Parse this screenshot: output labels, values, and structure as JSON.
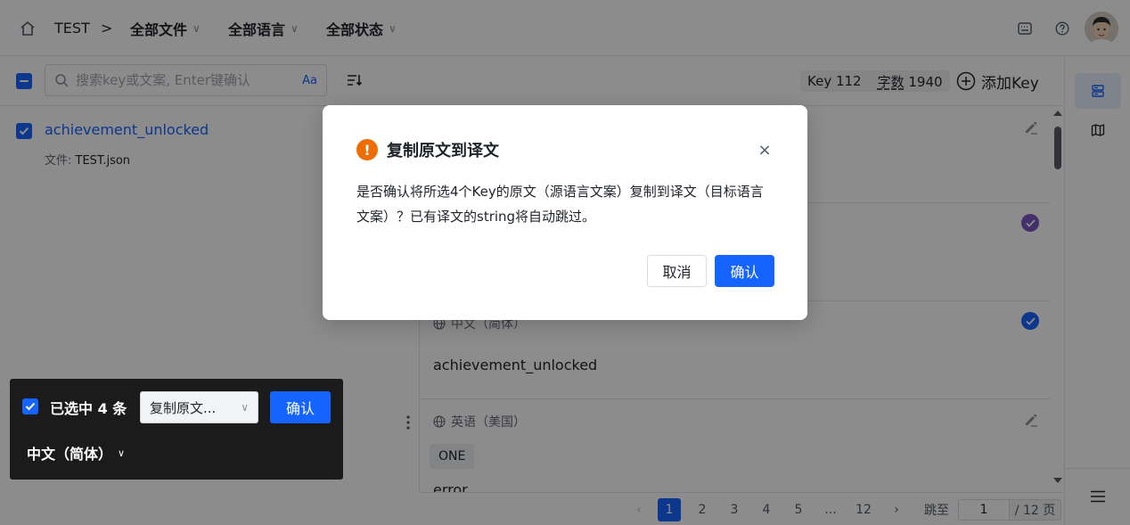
{
  "header": {
    "project": "TEST",
    "breadcrumb_sep": ">",
    "filters": [
      {
        "label": "全部文件"
      },
      {
        "label": "全部语言"
      },
      {
        "label": "全部状态"
      }
    ]
  },
  "toolbar": {
    "search_placeholder": "搜索key或文案, Enter键确认",
    "case_toggle": "Aa",
    "key_count_label": "Key 112",
    "word_count_label": "字数",
    "word_count_value": "1940",
    "add_key_label": "添加Key"
  },
  "key_list": [
    {
      "name": "achievement_unlocked",
      "file_label": "文件:",
      "file_name": "TEST.json"
    }
  ],
  "detail": {
    "sections": [
      {
        "lang": "中文（简体）",
        "text": "achievement_unlocked",
        "status": "verified"
      },
      {
        "lang": "英语（美国）",
        "plural_tag": "ONE",
        "text": "error"
      }
    ]
  },
  "pagination": {
    "pages": [
      "1",
      "2",
      "3",
      "4",
      "5",
      "...",
      "12"
    ],
    "current": "1",
    "jump_label": "跳至",
    "jump_value": "1",
    "total_label": "/ 12 页"
  },
  "dialog": {
    "title": "复制原文到译文",
    "body": "是否确认将所选4个Key的原文（源语言文案）复制到译文（目标语言文案）？已有译文的string将自动跳过。",
    "cancel_label": "取消",
    "ok_label": "确认"
  },
  "batch_bar": {
    "selected_label": "已选中 4 条",
    "action_value": "复制原文...",
    "confirm_label": "确认",
    "target_lang": "中文（简体）"
  },
  "colors": {
    "primary": "#1664ff",
    "warning": "#ef6c00",
    "verified_purple": "#7e57c2",
    "overlay": "rgba(0,0,0,0.45)"
  }
}
